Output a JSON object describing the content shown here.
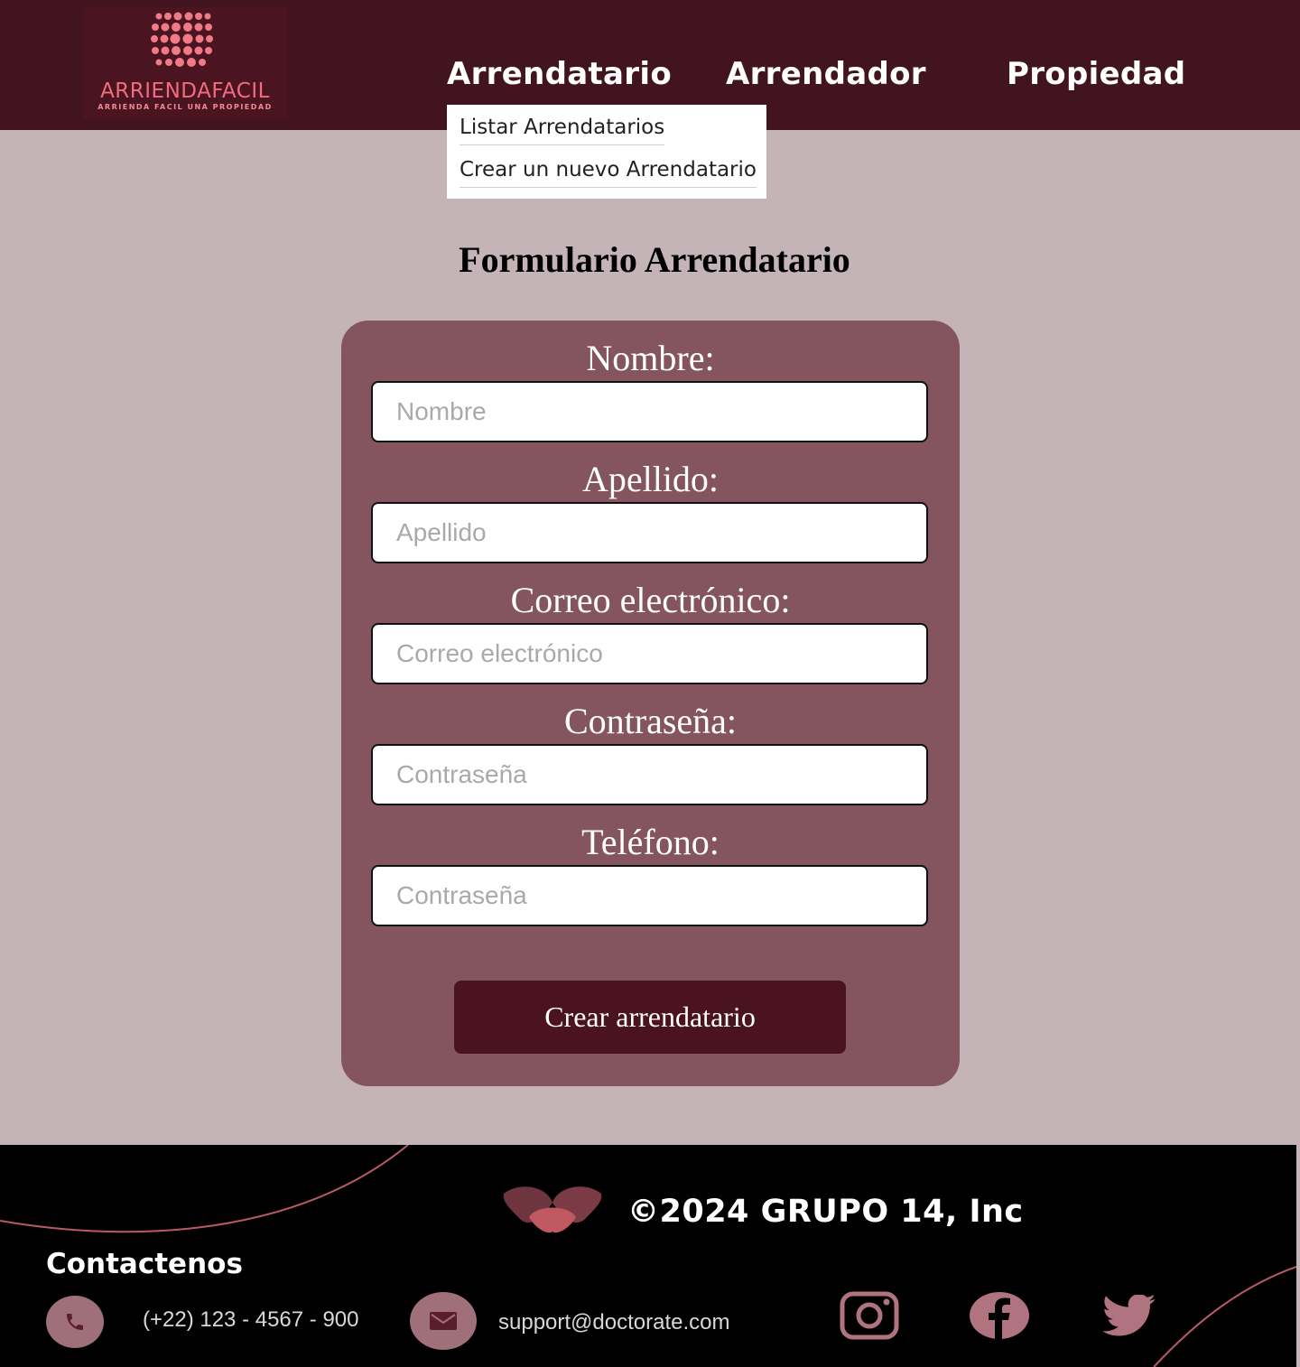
{
  "header": {
    "logo": {
      "name": "ARRIENDAFACIL",
      "tagline": "ARRIENDA FACIL UNA PROPIEDAD"
    },
    "nav": [
      {
        "label": "Arrendatario"
      },
      {
        "label": "Arrendador"
      },
      {
        "label": "Propiedad"
      }
    ],
    "dropdown": [
      {
        "label": "Listar Arrendatarios"
      },
      {
        "label": "Crear un nuevo Arrendatario"
      }
    ]
  },
  "main": {
    "title": "Formulario Arrendatario",
    "fields": [
      {
        "label": "Nombre:",
        "placeholder": "Nombre"
      },
      {
        "label": "Apellido:",
        "placeholder": "Apellido"
      },
      {
        "label": "Correo electrónico:",
        "placeholder": "Correo electrónico"
      },
      {
        "label": "Contraseña:",
        "placeholder": "Contraseña"
      },
      {
        "label": "Teléfono:",
        "placeholder": "Contraseña"
      }
    ],
    "submit_label": "Crear arrendatario"
  },
  "footer": {
    "copyright": "©2024 GRUPO 14, Inc",
    "contact_title": "Contactenos",
    "phone": "(+22) 123 - 4567 - 900",
    "email": "support@doctorate.com",
    "icons": {
      "phone": "phone-icon",
      "email": "mail-icon",
      "social": [
        "instagram-icon",
        "facebook-icon",
        "twitter-icon"
      ]
    }
  },
  "colors": {
    "header_bg": "#42141f",
    "page_bg": "#c4b4b7",
    "card_bg": "#85555f",
    "button_bg": "#4a131e",
    "accent": "#a0707a",
    "logo": "#f26b7e"
  }
}
